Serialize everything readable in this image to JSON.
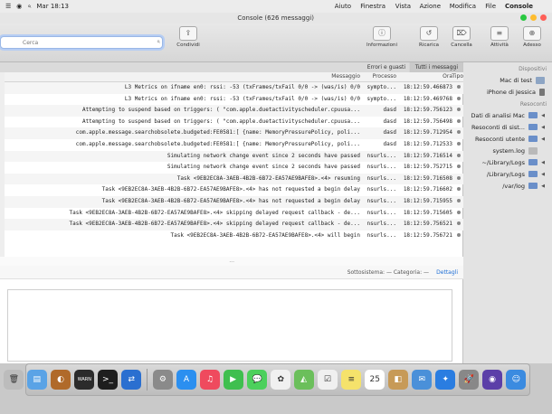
{
  "menubar": {
    "apple": "",
    "app": "Console",
    "items": [
      "File",
      "Modifica",
      "Azione",
      "Vista",
      "Finestra",
      "Aiuto"
    ],
    "clock": "Mar 18:13"
  },
  "window": {
    "title": "Console (626 messaggi)"
  },
  "toolbar": {
    "buttons": [
      {
        "label": "Adesso",
        "icon": "⊕"
      },
      {
        "label": "Attività",
        "icon": "≡"
      },
      {
        "label": "Cancella",
        "icon": "⌫"
      },
      {
        "label": "Ricarica",
        "icon": "↻"
      },
      {
        "label": "Informazioni",
        "icon": "ⓘ"
      },
      {
        "label": "Condividi",
        "icon": "⇪"
      }
    ],
    "search_placeholder": "Cerca"
  },
  "sidebar": {
    "devices_header": "Dispositivi",
    "devices": [
      "Mac di test",
      "iPhone di Jessica"
    ],
    "reports_header": "Resoconti",
    "reports": [
      "Dati di analisi Mac",
      "Resoconti di sist...",
      "Resoconti utente",
      "system.log",
      "~/Library/Logs",
      "/Library/Logs",
      "/var/log"
    ]
  },
  "tabs": [
    "Tutti i messaggi",
    "Errori e guasti"
  ],
  "table": {
    "headers": {
      "type": "Tipo",
      "time": "Ora",
      "process": "Processo",
      "message": "Messaggio"
    },
    "rows": [
      {
        "time": "18:12:59.466873",
        "process": "sympto...",
        "message": "L3 Metrics on ifname en0: rssi: -53 (txFrames/txFail 0/0 -> (was/is) 0/0"
      },
      {
        "time": "18:12:59.469768",
        "process": "sympto...",
        "message": "L3 Metrics on ifname en0: rssi: -53 (txFrames/txFail 0/0 -> (was/is) 0/0"
      },
      {
        "time": "18:12:59.756123",
        "process": "dasd",
        "message": "Attempting to suspend based on triggers: ( \"com.apple.duetactivityscheduler.cpuusa..."
      },
      {
        "time": "18:12:59.756498",
        "process": "dasd",
        "message": "Attempting to suspend based on triggers: ( \"com.apple.duetactivityscheduler.cpuusa..."
      },
      {
        "time": "18:12:59.712954",
        "process": "dasd",
        "message": "com.apple.message.searchobsolete.budgeted:FE0581:[ {name: MemoryPressurePolicy, poli..."
      },
      {
        "time": "18:12:59.712533",
        "process": "dasd",
        "message": "com.apple.message.searchobsolete.budgeted:FE0581:[ {name: MemoryPressurePolicy, poli..."
      },
      {
        "time": "18:12:59.716514",
        "process": "nsurls...",
        "message": "Simulating network change event since 2 seconds have passed"
      },
      {
        "time": "18:12:59.752715",
        "process": "nsurls...",
        "message": "Simulating network change event since 2 seconds have passed"
      },
      {
        "time": "18:12:59.716508",
        "process": "nsurls...",
        "message": "Task <9EB2EC8A-3AEB-4B2B-6B72-EA57AE9BAFE8>.<4> resuming"
      },
      {
        "time": "18:12:59.716602",
        "process": "nsurls...",
        "message": "Task <9EB2EC8A-3AEB-4B2B-6B72-EA57AE9BAFE8>.<4> has not requested a begin delay"
      },
      {
        "time": "18:12:59.715955",
        "process": "nsurls...",
        "message": "Task <9EB2EC8A-3AEB-4B2B-6B72-EA57AE9BAFE8>.<4> has not requested a begin delay"
      },
      {
        "time": "18:12:59.715605",
        "process": "nsurls...",
        "message": "Task <9EB2EC8A-3AEB-4B2B-6B72-EA57AE9BAFE8>.<4> skipping delayed request callback - de..."
      },
      {
        "time": "18:12:59.756521",
        "process": "nsurls...",
        "message": "Task <9EB2EC8A-3AEB-4B2B-6B72-EA57AE9BAFE8>.<4> skipping delayed request callback - de..."
      },
      {
        "time": "18:12:59.756721",
        "process": "nsurls...",
        "message": "Task <9EB2EC8A-3AEB-4B2B-6B72-EA57AE9BAFE8>.<4> will begin"
      }
    ]
  },
  "details": {
    "splitter": "...",
    "tab_details": "Dettagli",
    "tab_rest": "Sottosistema: — Categoria: —"
  },
  "dock": {
    "apps": [
      {
        "icon": "finder-icon",
        "color": "#3b8be0",
        "glyph": "☺"
      },
      {
        "icon": "siri-icon",
        "color": "#5b3fa8",
        "glyph": "◉"
      },
      {
        "icon": "launchpad-icon",
        "color": "#888888",
        "glyph": "🚀"
      },
      {
        "icon": "safari-icon",
        "color": "#2a7de1",
        "glyph": "✦"
      },
      {
        "icon": "mail-icon",
        "color": "#4a90d9",
        "glyph": "✉"
      },
      {
        "icon": "contacts-icon",
        "color": "#c79a57",
        "glyph": "◧"
      },
      {
        "icon": "calendar-icon",
        "color": "#ffffff",
        "glyph": "25"
      },
      {
        "icon": "notes-icon",
        "color": "#f5e26b",
        "glyph": "≡"
      },
      {
        "icon": "reminders-icon",
        "color": "#f0f0f0",
        "glyph": "☑"
      },
      {
        "icon": "maps-icon",
        "color": "#6bbf5b",
        "glyph": "◭"
      },
      {
        "icon": "photos-icon",
        "color": "#f0f0f0",
        "glyph": "✿"
      },
      {
        "icon": "messages-icon",
        "color": "#4cd05c",
        "glyph": "💬"
      },
      {
        "icon": "facetime-icon",
        "color": "#3fbf4f",
        "glyph": "▶"
      },
      {
        "icon": "music-icon",
        "color": "#ef4a5e",
        "glyph": "♫"
      },
      {
        "icon": "appstore-icon",
        "color": "#2b8ff0",
        "glyph": "A"
      },
      {
        "icon": "settings-icon",
        "color": "#8a8a8a",
        "glyph": "⚙"
      }
    ],
    "right": [
      {
        "icon": "remote-icon",
        "color": "#2a6fd0",
        "glyph": "⇄"
      },
      {
        "icon": "terminal-icon",
        "color": "#1e1e1e",
        "glyph": ">_"
      },
      {
        "icon": "console-icon",
        "color": "#2b2b2b",
        "glyph": "WARN"
      },
      {
        "icon": "vlc-icon",
        "color": "#b06a2a",
        "glyph": "◐"
      },
      {
        "icon": "preview-icon",
        "color": "#5aa3e6",
        "glyph": "▤"
      },
      {
        "icon": "trash-icon",
        "color": "#bcbcbc",
        "glyph": "🗑"
      }
    ]
  },
  "colors": {
    "accent": "#1f6fd6",
    "close": "#ff5f57",
    "minimize": "#febc2e",
    "zoom": "#28c840"
  }
}
